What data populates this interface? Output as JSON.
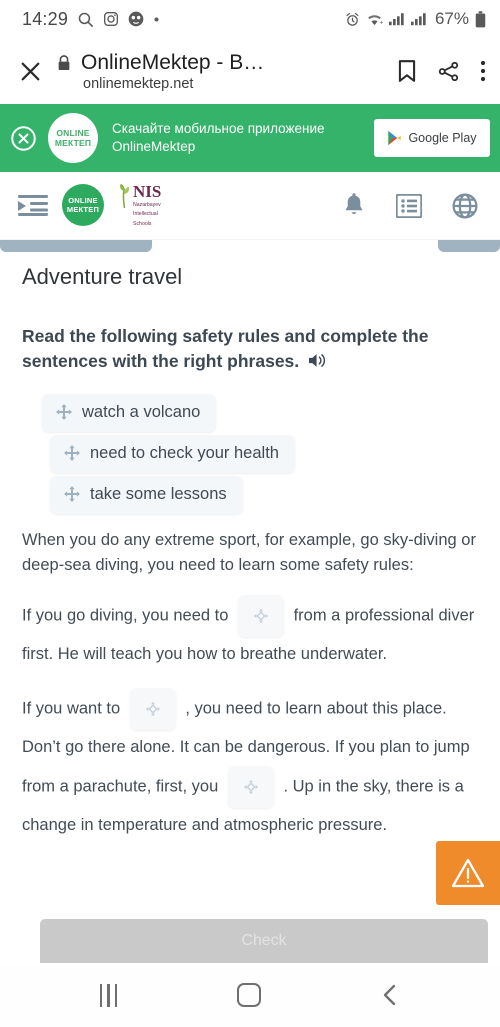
{
  "statusbar": {
    "time": "14:29",
    "left_icons": [
      "search-icon",
      "instagram-icon",
      "app-icon",
      "dot-icon"
    ],
    "right_icons": [
      "alarm-icon",
      "wifi-icon",
      "signal-icon",
      "signal-icon-2",
      "battery-icon"
    ],
    "battery_percent": "67%"
  },
  "browser": {
    "close_label": "close-tab",
    "lock_label": "secure",
    "title": "OnlineMektep - B…",
    "url": "onlinemektep.net",
    "actions": [
      "bookmark-icon",
      "share-icon",
      "more-menu-icon"
    ]
  },
  "promo": {
    "close_label": "close-banner",
    "logo_line1": "ONLINE",
    "logo_line2": "МЕКТЕП",
    "text_line1": "Скачайте мобильное приложение",
    "text_line2": "OnlineMektep",
    "store_button": "Google Play",
    "bg_color": "#35b36a"
  },
  "sitenav": {
    "menu_icon": "indent-menu-icon",
    "mektep_logo_line1": "ONLINE",
    "mektep_logo_line2": "МЕКТЕП",
    "nis_abbr": "NIS",
    "nis_sub_line1": "Nazarbayev",
    "nis_sub_line2": "Intellectual",
    "nis_sub_line3": "Schools",
    "right_icons": [
      "bell-icon",
      "list-icon",
      "globe-icon"
    ]
  },
  "lesson": {
    "title": "Adventure travel",
    "instruction": "Read the following safety rules and complete the sentences with the right phrases.",
    "audio_icon": "speaker-icon",
    "chips": [
      {
        "label": "watch a volcano"
      },
      {
        "label": "need to check your health"
      },
      {
        "label": "take some lessons"
      }
    ],
    "paragraph_1": "When you do any extreme sport, for example, go sky-diving or deep-sea diving, you need to learn some safety rules:",
    "paragraph_2_a": "If you go diving, you need to",
    "paragraph_2_b": "from a professional diver first. He will teach you how to breathe underwater.",
    "paragraph_3_a": "If you want to",
    "paragraph_3_b": ", you need to learn about this place. Don’t go there alone. It can be dangerous. If you plan to jump from a parachute, first, you",
    "paragraph_3_c": ". Up in the sky, there is a change in temperature and atmospheric pressure.",
    "check_button": "Check",
    "warning_button": "warning-icon",
    "warning_color": "#f08b2c"
  },
  "androidnav": {
    "recents_label": "recents",
    "home_label": "home",
    "back_label": "back"
  }
}
